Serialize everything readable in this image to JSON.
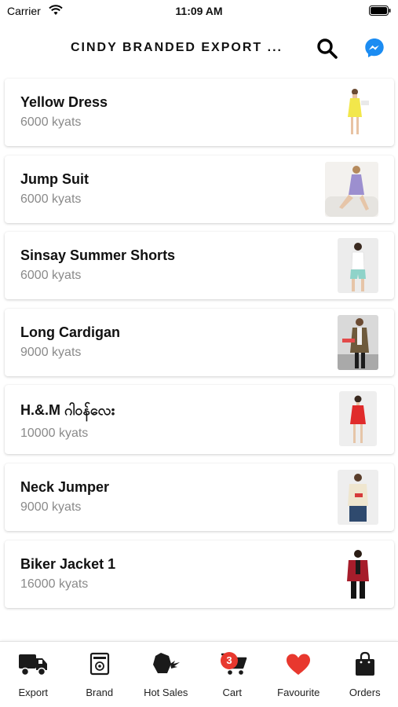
{
  "status_bar": {
    "carrier": "Carrier",
    "time": "11:09 AM"
  },
  "header": {
    "title": "CINDY BRANDED EXPORT ...",
    "search_icon": "search-icon",
    "messenger_icon": "messenger-icon",
    "messenger_color": "#1b8cf2"
  },
  "products": [
    {
      "name": "Yellow Dress",
      "price": "6000 kyats",
      "image": "yellow-dress-photo"
    },
    {
      "name": "Jump Suit",
      "price": "6000 kyats",
      "image": "jump-suit-photo"
    },
    {
      "name": "Sinsay Summer Shorts",
      "price": "6000 kyats",
      "image": "summer-shorts-photo"
    },
    {
      "name": "Long Cardigan",
      "price": "9000 kyats",
      "image": "long-cardigan-photo"
    },
    {
      "name": "H.&.M ဂါဝန်လေး",
      "price": "10000 kyats",
      "image": "red-dress-photo"
    },
    {
      "name": "Neck Jumper",
      "price": "9000 kyats",
      "image": "neck-jumper-photo"
    },
    {
      "name": "Biker Jacket 1",
      "price": "16000 kyats",
      "image": "biker-jacket-photo"
    }
  ],
  "bottom_nav": {
    "items": [
      {
        "label": "Export",
        "icon": "truck-icon"
      },
      {
        "label": "Brand",
        "icon": "brand-tag-icon"
      },
      {
        "label": "Hot Sales",
        "icon": "hot-sales-icon"
      },
      {
        "label": "Cart",
        "icon": "cart-icon"
      },
      {
        "label": "Favourite",
        "icon": "heart-icon"
      },
      {
        "label": "Orders",
        "icon": "shopping-bag-icon"
      }
    ],
    "cart_count": "3",
    "badge_color": "#e8382e",
    "heart_color": "#e8382e"
  }
}
